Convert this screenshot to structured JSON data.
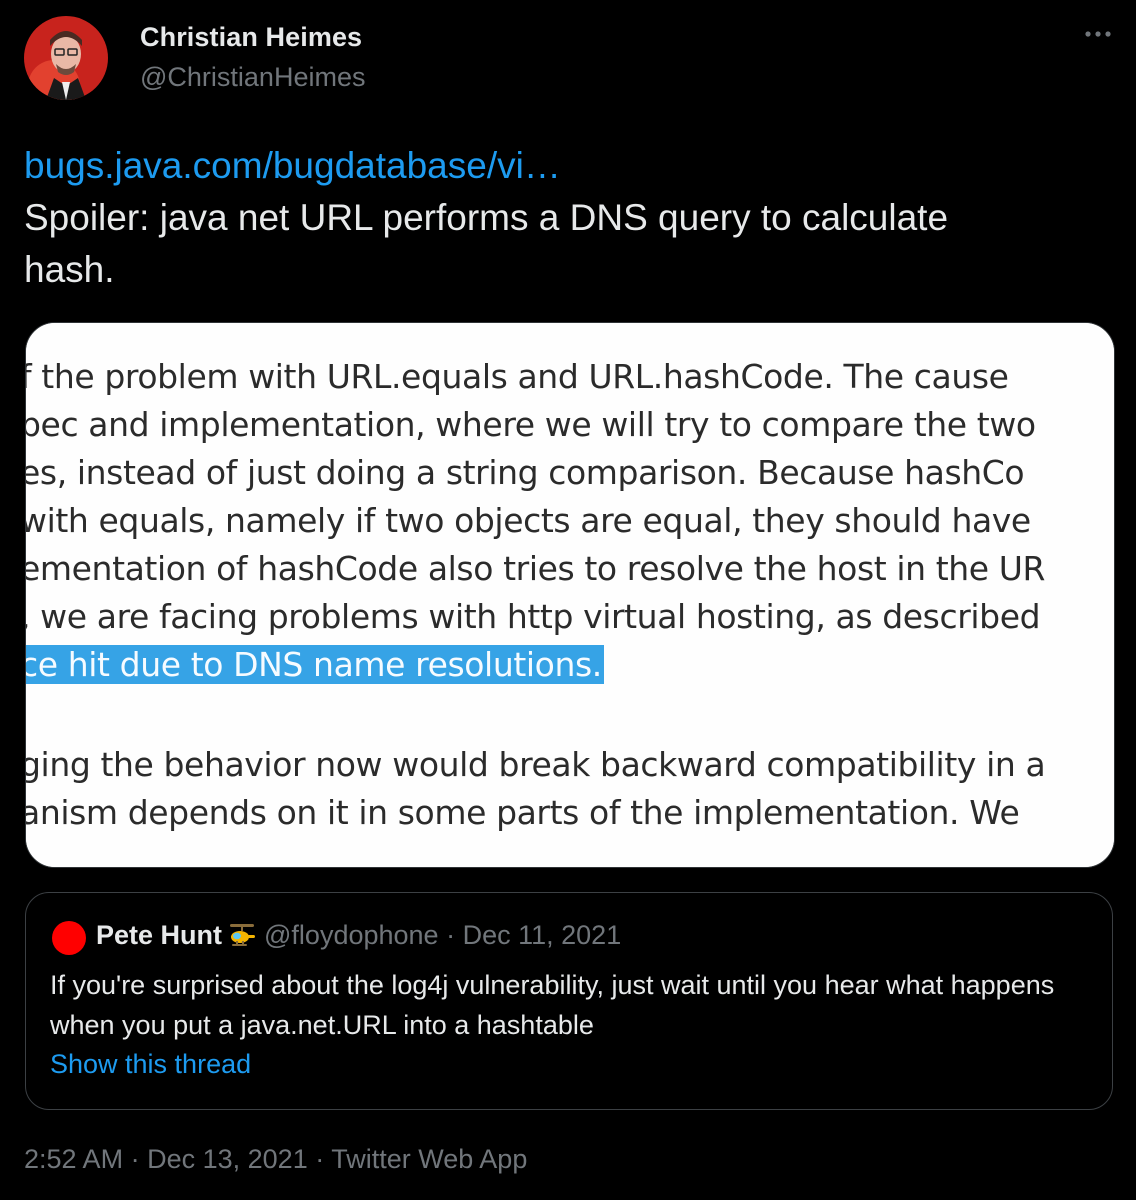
{
  "author": {
    "display_name": "Christian Heimes",
    "handle": "@ChristianHeimes",
    "avatar_icon": "profile-photo",
    "more_icon": "more-horizontal-icon"
  },
  "tweet": {
    "link_text": "bugs.java.com/bugdatabase/vi…",
    "text": "Spoiler: java net URL performs a DNS query to calculate hash."
  },
  "media": {
    "lines": [
      "f the problem with URL.equals and URL.hashCode. The cause",
      "pec and implementation, where we will try to compare the two",
      "es, instead of just doing a string comparison. Because hashCo",
      " with equals, namely if two objects are equal, they should have",
      "ementation of hashCode also tries to resolve the host in the UR",
      ", we are facing problems with http virtual hosting, as described",
      "ce hit due to DNS name resolutions.",
      "ging the behavior now would break  backward compatibility in a",
      "anism depends on it in some parts of the implementation. We"
    ],
    "highlight_color": "#36a3e6"
  },
  "quoted_tweet": {
    "name": "Pete Hunt",
    "emoji_icon": "helicopter-emoji-icon",
    "handle": "@floydophone",
    "separator": "·",
    "date": "Dec 11, 2021",
    "text": "If you're surprised about the log4j vulnerability, just wait until you hear what happens when you put a java.net.URL into a hashtable",
    "show_thread": "Show this thread",
    "avatar_color": "#ff0000"
  },
  "footer": {
    "time": "2:52 AM",
    "separator": "·",
    "date": "Dec 13, 2021",
    "source": "Twitter Web App"
  },
  "colors": {
    "background": "#000000",
    "link": "#1d9bf0",
    "secondary": "#71767b",
    "primary_text": "#e7e9ea"
  }
}
